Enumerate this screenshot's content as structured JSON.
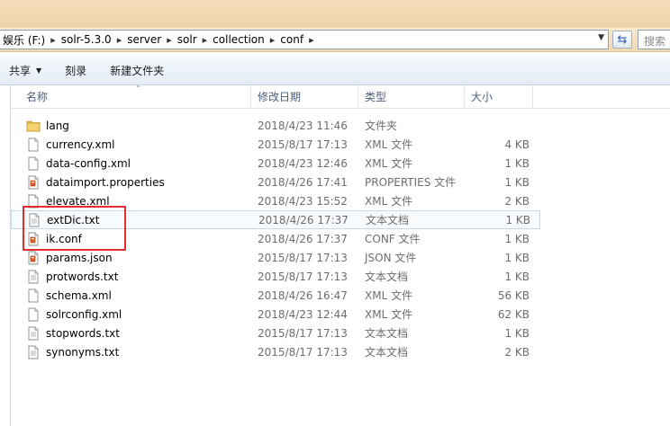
{
  "address": {
    "crumbs": [
      "娱乐 (F:)",
      "solr-5.3.0",
      "server",
      "solr",
      "collection",
      "conf"
    ],
    "search_placeholder": "搜索"
  },
  "toolbar": {
    "share_label": "共享",
    "burn_label": "刻录",
    "new_folder_label": "新建文件夹"
  },
  "columns": {
    "name": "名称",
    "date": "修改日期",
    "type": "类型",
    "size": "大小"
  },
  "files": [
    {
      "name": "lang",
      "date": "2018/4/23 11:46",
      "type": "文件夹",
      "size": "",
      "icon": "folder-icon"
    },
    {
      "name": "currency.xml",
      "date": "2015/8/17 17:13",
      "type": "XML 文件",
      "size": "4 KB",
      "icon": "document-icon"
    },
    {
      "name": "data-config.xml",
      "date": "2018/4/23 12:46",
      "type": "XML 文件",
      "size": "1 KB",
      "icon": "document-icon"
    },
    {
      "name": "dataimport.properties",
      "date": "2018/4/26 17:41",
      "type": "PROPERTIES 文件",
      "size": "1 KB",
      "icon": "config-file-icon"
    },
    {
      "name": "elevate.xml",
      "date": "2018/4/23 15:52",
      "type": "XML 文件",
      "size": "2 KB",
      "icon": "document-icon"
    },
    {
      "name": "extDic.txt",
      "date": "2018/4/26 17:37",
      "type": "文本文档",
      "size": "1 KB",
      "icon": "text-file-icon"
    },
    {
      "name": "ik.conf",
      "date": "2018/4/26 17:37",
      "type": "CONF 文件",
      "size": "1 KB",
      "icon": "config-file-icon"
    },
    {
      "name": "params.json",
      "date": "2015/8/17 17:13",
      "type": "JSON 文件",
      "size": "1 KB",
      "icon": "config-file-icon"
    },
    {
      "name": "protwords.txt",
      "date": "2015/8/17 17:13",
      "type": "文本文档",
      "size": "1 KB",
      "icon": "text-file-icon"
    },
    {
      "name": "schema.xml",
      "date": "2018/4/26 16:47",
      "type": "XML 文件",
      "size": "56 KB",
      "icon": "document-icon"
    },
    {
      "name": "solrconfig.xml",
      "date": "2018/4/23 12:44",
      "type": "XML 文件",
      "size": "62 KB",
      "icon": "document-icon"
    },
    {
      "name": "stopwords.txt",
      "date": "2015/8/17 17:13",
      "type": "文本文档",
      "size": "1 KB",
      "icon": "text-file-icon"
    },
    {
      "name": "synonyms.txt",
      "date": "2015/8/17 17:13",
      "type": "文本文档",
      "size": "2 KB",
      "icon": "text-file-icon"
    }
  ],
  "colors": {
    "highlight": "#e03030",
    "header_text": "#4c607a",
    "folder": "#e8c15a"
  }
}
